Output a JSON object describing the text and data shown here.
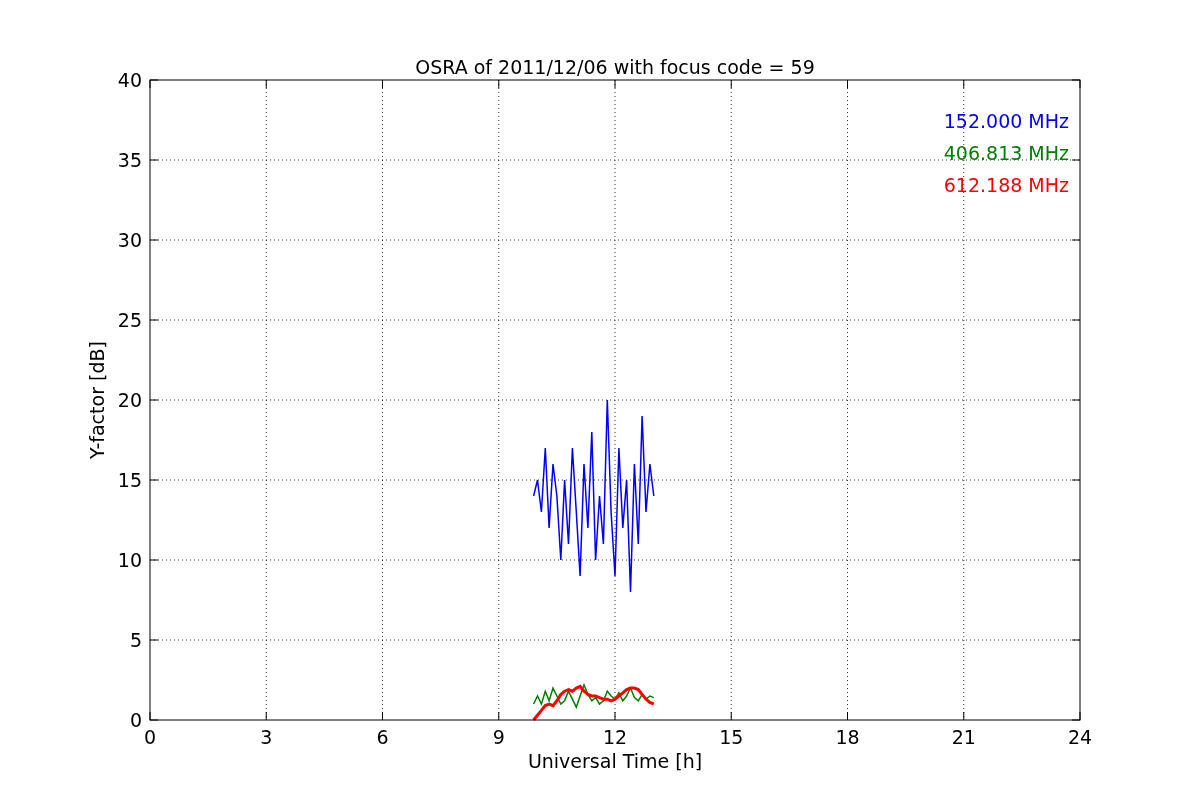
{
  "chart_data": {
    "type": "line",
    "title": "OSRA of 2011/12/06 with focus code = 59",
    "xlabel": "Universal Time [h]",
    "ylabel": "Y-factor [dB]",
    "x": [
      9.9,
      10.0,
      10.1,
      10.2,
      10.3,
      10.4,
      10.5,
      10.6,
      10.7,
      10.8,
      10.9,
      11.0,
      11.1,
      11.2,
      11.3,
      11.4,
      11.5,
      11.6,
      11.7,
      11.8,
      11.9,
      12.0,
      12.1,
      12.2,
      12.3,
      12.4,
      12.5,
      12.6,
      12.7,
      12.8,
      12.9,
      13.0
    ],
    "series": [
      {
        "name": "152.000 MHz",
        "color": "#0000ff",
        "values": [
          14,
          15,
          13,
          17,
          12,
          16,
          14,
          10,
          15,
          11,
          17,
          13,
          9,
          16,
          12,
          18,
          10,
          14,
          11,
          20,
          13,
          9,
          17,
          12,
          15,
          8,
          16,
          11,
          19,
          13,
          16,
          14
        ]
      },
      {
        "name": "406.813 MHz",
        "color": "#008000",
        "values": [
          1,
          1.5,
          1,
          1.8,
          1.2,
          2,
          1.5,
          1,
          1.2,
          1.8,
          1.3,
          0.8,
          1.5,
          2.2,
          1.6,
          1.2,
          1.4,
          1,
          1.2,
          1.8,
          1.5,
          1.3,
          1.7,
          1.2,
          1.5,
          2,
          1.4,
          1.2,
          1.6,
          1.3,
          1.5,
          1.4
        ]
      },
      {
        "name": "612.188 MHz",
        "color": "#ff0000",
        "values": [
          0,
          0.3,
          0.6,
          0.9,
          1,
          0.9,
          1.2,
          1.6,
          1.8,
          1.9,
          1.8,
          2,
          2.1,
          1.8,
          1.6,
          1.5,
          1.5,
          1.4,
          1.3,
          1.3,
          1.2,
          1.3,
          1.5,
          1.7,
          1.9,
          2,
          2,
          1.9,
          1.6,
          1.3,
          1.1,
          1
        ]
      }
    ],
    "grid": true,
    "xlim": [
      0,
      24
    ],
    "ylim": [
      0,
      40
    ],
    "xticks": [
      0,
      3,
      6,
      9,
      12,
      15,
      18,
      21,
      24
    ],
    "yticks": [
      0,
      5,
      10,
      15,
      20,
      25,
      30,
      35,
      40
    ]
  }
}
